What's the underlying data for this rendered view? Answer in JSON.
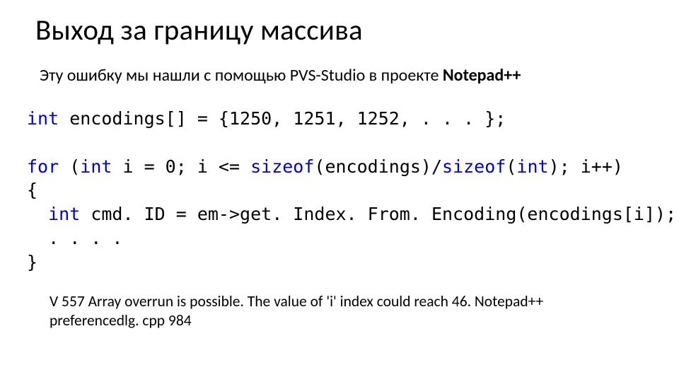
{
  "title": "Выход за границу массива",
  "subtitle_pre": "Эту ошибку мы нашли с помощью PVS-Studio в проекте ",
  "subtitle_bold": "Notepad++",
  "code": {
    "l1_kw": "int",
    "l1_rest": " encodings[] = {1250, 1251, 1252, . . . };",
    "l2_for": "for",
    "l2_a": " (",
    "l2_int": "int",
    "l2_b": " i = 0; i <= ",
    "l2_sizeof1": "sizeof",
    "l2_c": "(encodings)/",
    "l2_sizeof2": "sizeof",
    "l2_d": "(",
    "l2_int2": "int",
    "l2_e": "); i++)",
    "l3": "{",
    "l4_indent": "  ",
    "l4_int": "int",
    "l4_rest": " cmd. ID = em->get. Index. From. Encoding(encodings[i]);",
    "l5": "  . . . .",
    "l6": "}"
  },
  "footnote": "V 557 Array overrun is possible. The value of 'i' index could reach 46.  Notepad++ preferencedlg. cpp  984"
}
